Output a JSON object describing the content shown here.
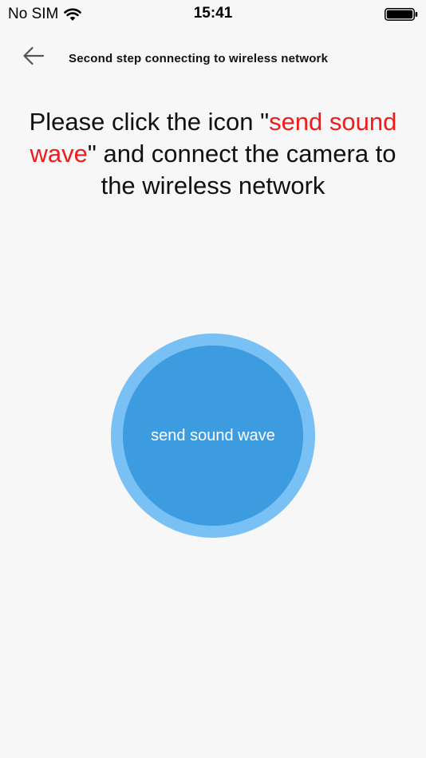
{
  "status_bar": {
    "carrier": "No SIM",
    "time": "15:41",
    "wifi_icon": "wifi-icon",
    "battery_icon": "battery-icon"
  },
  "header": {
    "back_icon": "back-arrow-icon",
    "title": "Second step connecting to wireless network"
  },
  "instruction": {
    "part1": "Please click the icon \"",
    "highlight": "send sound wave",
    "part2": "\" and connect the camera to the wireless network"
  },
  "sound_wave_button": {
    "label": "send sound wave"
  },
  "colors": {
    "background": "#f7f7f7",
    "highlight_text": "#ee1c1c",
    "button_outer_ring": "#79c0f5",
    "button_inner": "#3d9ce0",
    "button_text": "#ffffff"
  }
}
